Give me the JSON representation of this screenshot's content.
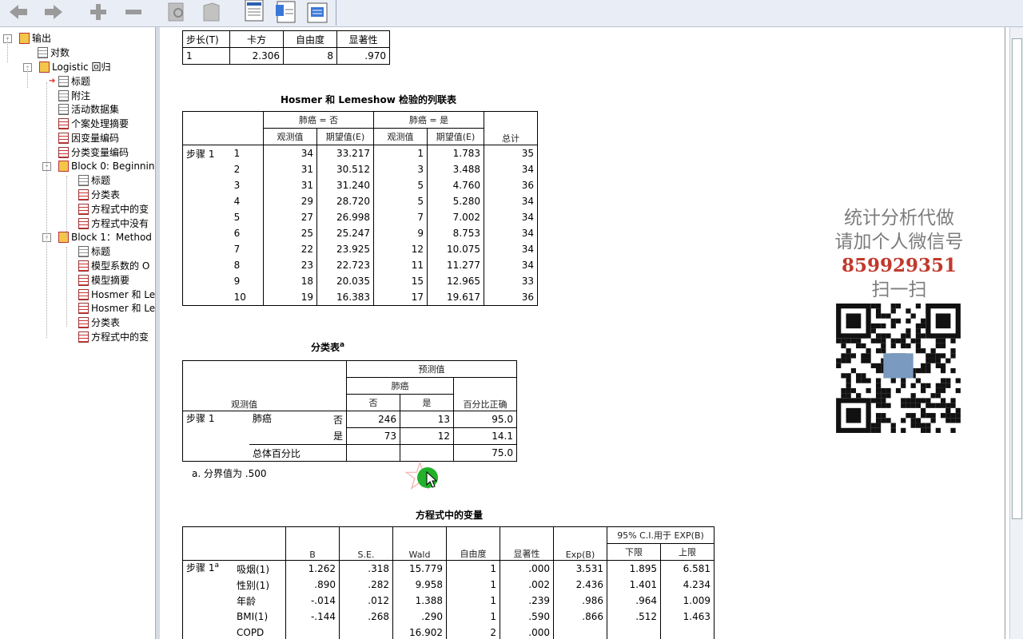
{
  "outline": {
    "items": [
      {
        "label": "输出",
        "level": 0
      },
      {
        "label": "对数",
        "level": 1
      },
      {
        "label": "Logistic 回归",
        "level": 1
      },
      {
        "label": "标题",
        "level": 2
      },
      {
        "label": "附注",
        "level": 2
      },
      {
        "label": "活动数据集",
        "level": 2
      },
      {
        "label": "个案处理摘要",
        "level": 2
      },
      {
        "label": "因变量编码",
        "level": 2
      },
      {
        "label": "分类变量编码",
        "level": 2
      },
      {
        "label": "Block 0: Beginning",
        "level": 2
      },
      {
        "label": "标题",
        "level": 3
      },
      {
        "label": "分类表",
        "level": 3
      },
      {
        "label": "方程式中的变",
        "level": 3
      },
      {
        "label": "方程式中没有",
        "level": 3
      },
      {
        "label": "Block 1：Method =",
        "level": 2
      },
      {
        "label": "标题",
        "level": 3
      },
      {
        "label": "模型系数的 O",
        "level": 3
      },
      {
        "label": "模型摘要",
        "level": 3
      },
      {
        "label": "Hosmer 和 Le",
        "level": 3
      },
      {
        "label": "Hosmer 和 Le",
        "level": 3
      },
      {
        "label": "分类表",
        "level": 3
      },
      {
        "label": "方程式中的变",
        "level": 3
      }
    ]
  },
  "hl_test": {
    "headers": [
      "步长(T)",
      "卡方",
      "自由度",
      "显著性"
    ],
    "row": [
      "1",
      "2.306",
      "8",
      ".970"
    ]
  },
  "contingency": {
    "title": "Hosmer 和 Lemeshow 检验的列联表",
    "group_no": "肺癌 = 否",
    "group_yes": "肺癌 = 是",
    "obs": "观测值",
    "exp": "期望值(E)",
    "total": "总计",
    "step": "步骤 1",
    "rows": [
      [
        "1",
        "34",
        "33.217",
        "1",
        "1.783",
        "35"
      ],
      [
        "2",
        "31",
        "30.512",
        "3",
        "3.488",
        "34"
      ],
      [
        "3",
        "31",
        "31.240",
        "5",
        "4.760",
        "36"
      ],
      [
        "4",
        "29",
        "28.720",
        "5",
        "5.280",
        "34"
      ],
      [
        "5",
        "27",
        "26.998",
        "7",
        "7.002",
        "34"
      ],
      [
        "6",
        "25",
        "25.247",
        "9",
        "8.753",
        "34"
      ],
      [
        "7",
        "22",
        "23.925",
        "12",
        "10.075",
        "34"
      ],
      [
        "8",
        "23",
        "22.723",
        "11",
        "11.277",
        "34"
      ],
      [
        "9",
        "18",
        "20.035",
        "15",
        "12.965",
        "33"
      ],
      [
        "10",
        "19",
        "16.383",
        "17",
        "19.617",
        "36"
      ]
    ]
  },
  "classification": {
    "title": "分类表",
    "title_sup": "a",
    "predicted": "预测值",
    "lung": "肺癌",
    "no": "否",
    "yes": "是",
    "pct": "百分比正确",
    "observed": "观测值",
    "step": "步骤 1",
    "lung_row": "肺癌",
    "r_no": [
      "否",
      "246",
      "13",
      "95.0"
    ],
    "r_yes": [
      "是",
      "73",
      "12",
      "14.1"
    ],
    "overall": "总体百分比",
    "overall_val": "75.0",
    "footnote": "a. 分界值为 .500"
  },
  "variables": {
    "title": "方程式中的变量",
    "ci_header": "95% C.I.用于 EXP(B)",
    "headers": [
      "B",
      "S.E.",
      "Wald",
      "自由度",
      "显著性",
      "Exp(B)",
      "下限",
      "上限"
    ],
    "step": "步骤 1",
    "step_sup": "a",
    "rows": [
      [
        "吸烟(1)",
        "1.262",
        ".318",
        "15.779",
        "1",
        ".000",
        "3.531",
        "1.895",
        "6.581"
      ],
      [
        "性别(1)",
        ".890",
        ".282",
        "9.958",
        "1",
        ".002",
        "2.436",
        "1.401",
        "4.234"
      ],
      [
        "年龄",
        "-.014",
        ".012",
        "1.388",
        "1",
        ".239",
        ".986",
        ".964",
        "1.009"
      ],
      [
        "BMI(1)",
        "-.144",
        ".268",
        ".290",
        "1",
        ".590",
        ".866",
        ".512",
        "1.463"
      ],
      [
        "COPD",
        "",
        "",
        "16.902",
        "2",
        ".000",
        "",
        "",
        ""
      ]
    ]
  },
  "watermark": {
    "line1": "统计分析代做",
    "line2_prefix": "请加个人微信号",
    "line2_num": "859929351",
    "line3": "扫一扫"
  }
}
